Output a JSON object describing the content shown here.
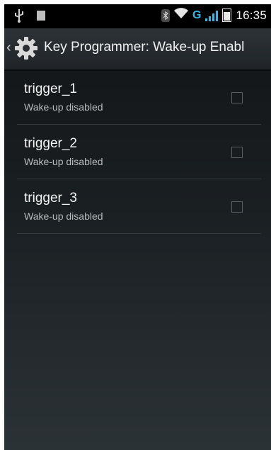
{
  "status_bar": {
    "time": "16:35",
    "network_label": "G",
    "accent_color": "#33b5e5"
  },
  "action_bar": {
    "title": "Key Programmer: Wake-up Enabl",
    "app_icon": "gear-icon",
    "up_icon": "chevron-left-icon"
  },
  "list": {
    "items": [
      {
        "title": "trigger_1",
        "subtitle": "Wake-up disabled",
        "checked": false
      },
      {
        "title": "trigger_2",
        "subtitle": "Wake-up disabled",
        "checked": false
      },
      {
        "title": "trigger_3",
        "subtitle": "Wake-up disabled",
        "checked": false
      }
    ]
  }
}
